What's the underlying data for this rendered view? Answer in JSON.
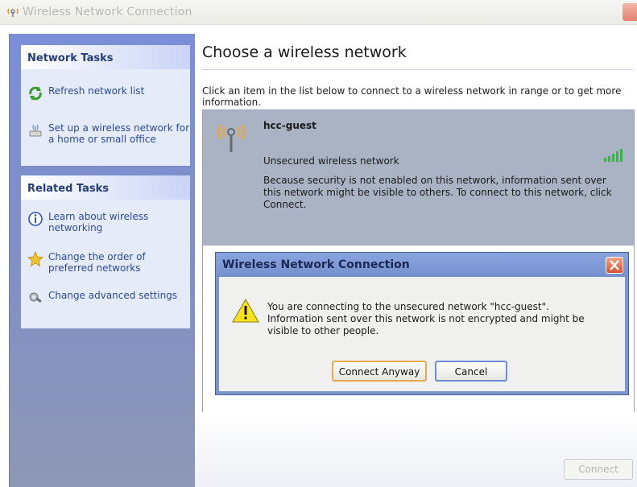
{
  "window": {
    "title": "Wireless Network Connection"
  },
  "left_pane": {
    "network_tasks": {
      "header": "Network Tasks",
      "items": [
        {
          "label": "Refresh network list",
          "icon": "refresh-icon"
        },
        {
          "label": "Set up a wireless network for a home or small office",
          "icon": "setup-wizard-icon"
        }
      ]
    },
    "related_tasks": {
      "header": "Related Tasks",
      "items": [
        {
          "label": "Learn about wireless networking",
          "icon": "info-icon"
        },
        {
          "label": "Change the order of preferred networks",
          "icon": "star-icon"
        },
        {
          "label": "Change advanced settings",
          "icon": "settings-icon"
        }
      ]
    }
  },
  "main": {
    "heading": "Choose a wireless network",
    "instruction": "Click an item in the list below to connect to a wireless network in range or to get more information.",
    "network": {
      "ssid": "hcc-guest",
      "security": "Unsecured wireless network",
      "description": "Because security is not enabled on this network, information sent over this network might be visible to others. To connect to this network, click Connect."
    },
    "connect_label": "Connect"
  },
  "dialog": {
    "title": "Wireless Network Connection",
    "message": "You are connecting to the unsecured network \"hcc-guest\". Information sent over this network is not encrypted and might be visible to other people.",
    "primary_button": "Connect Anyway",
    "secondary_button": "Cancel"
  },
  "colors": {
    "left_pane": "#7f8fc8",
    "selected_item": "#a9b3c3",
    "dialog_frame": "#7d95cf",
    "link_text": "#2b4b96"
  }
}
